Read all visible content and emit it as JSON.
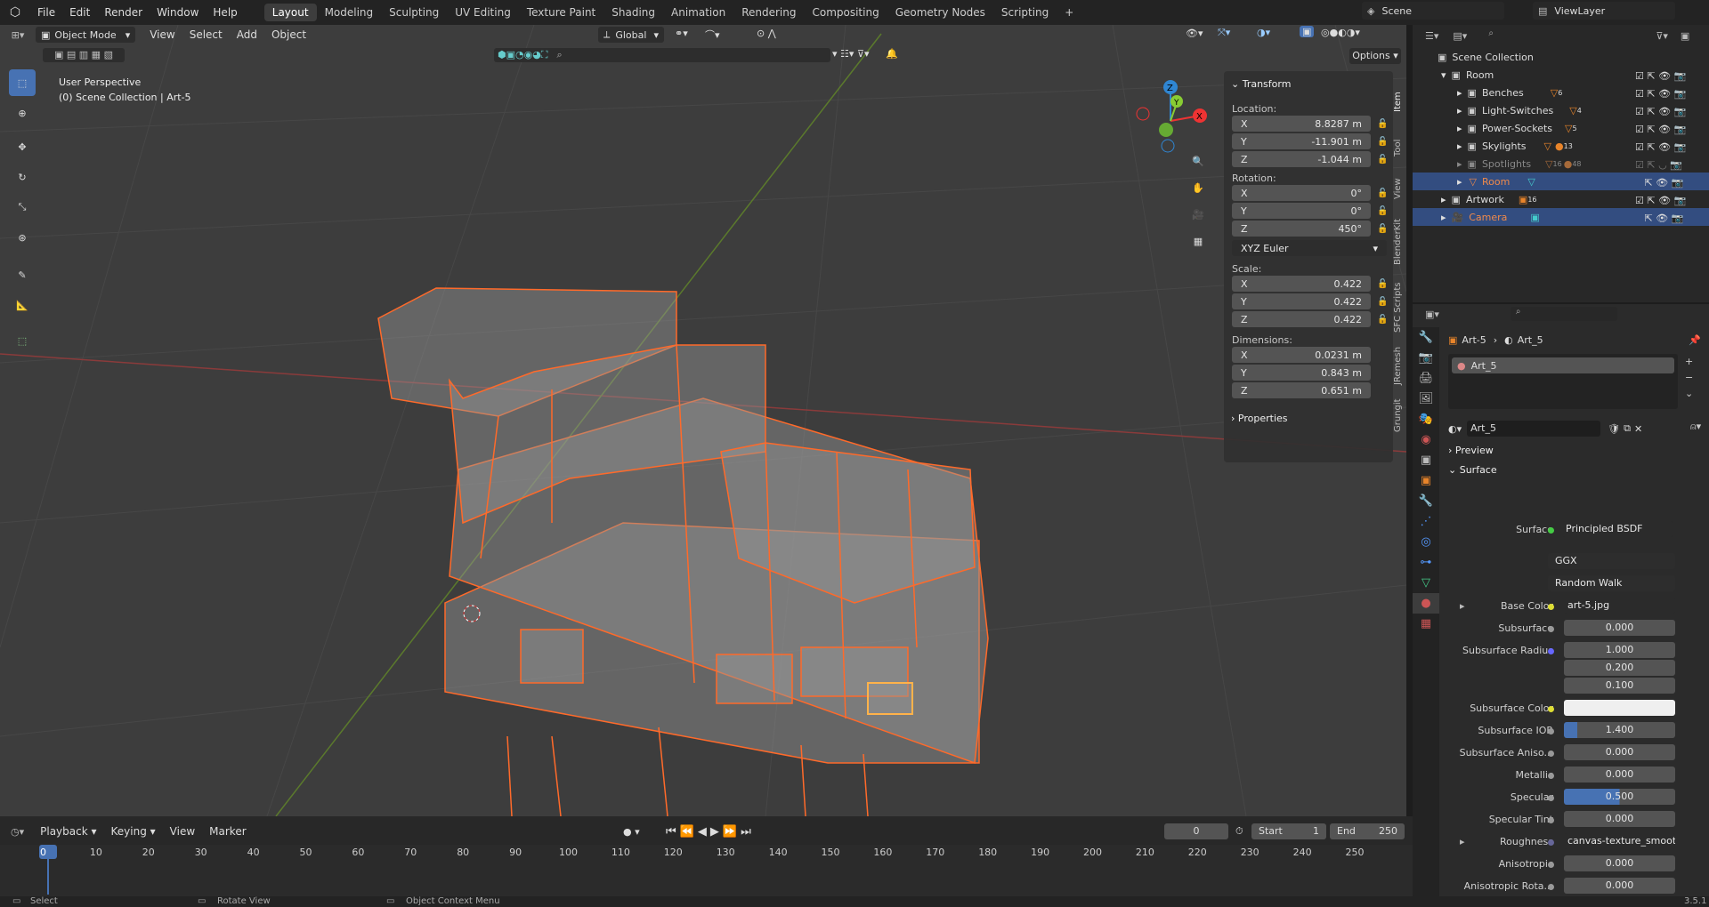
{
  "menu": {
    "file": "File",
    "edit": "Edit",
    "render": "Render",
    "window": "Window",
    "help": "Help"
  },
  "workspaces": [
    "Layout",
    "Modeling",
    "Sculpting",
    "UV Editing",
    "Texture Paint",
    "Shading",
    "Animation",
    "Rendering",
    "Compositing",
    "Geometry Nodes",
    "Scripting"
  ],
  "add_workspace": "+",
  "scene_name": "Scene",
  "view_layer": "ViewLayer",
  "viewport": {
    "mode": "Object Mode",
    "menus": [
      "View",
      "Select",
      "Add",
      "Object"
    ],
    "transform_orientation": "Global",
    "options": "Options",
    "perspective": "User Perspective",
    "collection_info": "(0) Scene Collection | Art-5"
  },
  "gizmo": {
    "x": "X",
    "y": "Y",
    "z": "Z"
  },
  "npanel": {
    "header": "Transform",
    "location_label": "Location:",
    "location": [
      {
        "axis": "X",
        "value": "8.8287 m"
      },
      {
        "axis": "Y",
        "value": "-11.901 m"
      },
      {
        "axis": "Z",
        "value": "-1.044 m"
      }
    ],
    "rotation_label": "Rotation:",
    "rotation": [
      {
        "axis": "X",
        "value": "0°"
      },
      {
        "axis": "Y",
        "value": "0°"
      },
      {
        "axis": "Z",
        "value": "450°"
      }
    ],
    "rotation_mode": "XYZ Euler",
    "scale_label": "Scale:",
    "scale": [
      {
        "axis": "X",
        "value": "0.422"
      },
      {
        "axis": "Y",
        "value": "0.422"
      },
      {
        "axis": "Z",
        "value": "0.422"
      }
    ],
    "dimensions_label": "Dimensions:",
    "dimensions": [
      {
        "axis": "X",
        "value": "0.0231 m"
      },
      {
        "axis": "Y",
        "value": "0.843 m"
      },
      {
        "axis": "Z",
        "value": "0.651 m"
      }
    ],
    "properties": "Properties"
  },
  "side_tabs": [
    "Item",
    "Tool",
    "View",
    "BlenderKit",
    "SFC Scripts",
    "JRemesh",
    "Grungit"
  ],
  "outliner": {
    "root": "Scene Collection",
    "items": [
      {
        "label": "Room",
        "count": ""
      },
      {
        "label": "Benches",
        "count": "6"
      },
      {
        "label": "Light-Switches",
        "count": "4"
      },
      {
        "label": "Power-Sockets",
        "count": "5"
      },
      {
        "label": "Skylights",
        "count": "13"
      },
      {
        "label": "Spotlights",
        "count": "16"
      },
      {
        "label": "Room",
        "count": ""
      },
      {
        "label": "Artwork",
        "count": "16"
      },
      {
        "label": "Camera",
        "count": ""
      }
    ],
    "spotlights_extra": "48"
  },
  "properties": {
    "breadcrumb_object": "Art-5",
    "breadcrumb_material": "Art_5",
    "slot": "Art_5",
    "material_name": "Art_5",
    "preview": "Preview",
    "surface_section": "Surface",
    "rows": [
      {
        "label": "Surface",
        "value": "Principled BSDF"
      },
      {
        "label": "",
        "value": "GGX"
      },
      {
        "label": "",
        "value": "Random Walk"
      },
      {
        "label": "Base Color",
        "value": "art-5.jpg"
      },
      {
        "label": "Subsurface",
        "value": "0.000"
      },
      {
        "label": "Subsurface Radius",
        "value": "1.000"
      },
      {
        "label": "",
        "value": "0.200"
      },
      {
        "label": "",
        "value": "0.100"
      },
      {
        "label": "Subsurface Color",
        "value": ""
      },
      {
        "label": "Subsurface IOR",
        "value": "1.400"
      },
      {
        "label": "Subsurface Aniso...",
        "value": "0.000"
      },
      {
        "label": "Metallic",
        "value": "0.000"
      },
      {
        "label": "Specular",
        "value": "0.500"
      },
      {
        "label": "Specular Tint",
        "value": "0.000"
      },
      {
        "label": "Roughness",
        "value": "canvas-texture_smoot..."
      },
      {
        "label": "Anisotropic",
        "value": "0.000"
      },
      {
        "label": "Anisotropic Rota...",
        "value": "0.000"
      }
    ]
  },
  "timeline": {
    "menus": [
      "Playback",
      "Keying",
      "View",
      "Marker"
    ],
    "current_frame": "0",
    "start_label": "Start",
    "start": "1",
    "end_label": "End",
    "end": "250",
    "ticks": [
      "0",
      "10",
      "20",
      "30",
      "40",
      "50",
      "60",
      "70",
      "80",
      "90",
      "100",
      "110",
      "120",
      "130",
      "140",
      "150",
      "160",
      "170",
      "180",
      "190",
      "200",
      "210",
      "220",
      "230",
      "240",
      "250"
    ]
  },
  "status": {
    "select": "Select",
    "rotate": "Rotate View",
    "context": "Object Context Menu",
    "version": "3.5.1"
  },
  "colors": {
    "accent": "#4772b3",
    "selection": "#e8642a",
    "active": "#ffaa40"
  }
}
